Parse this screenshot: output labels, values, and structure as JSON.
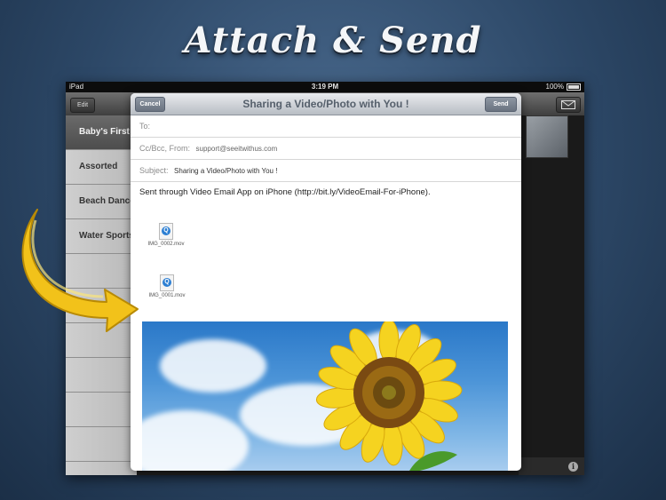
{
  "headline": "Attach & Send",
  "status_bar": {
    "device": "iPad",
    "time": "3:19 PM",
    "battery": "100%"
  },
  "navbar": {
    "edit_label": "Edit"
  },
  "sidebar": {
    "items": [
      {
        "label": "Baby's First",
        "selected": true
      },
      {
        "label": "Assorted",
        "selected": false
      },
      {
        "label": "Beach Dance",
        "selected": false
      },
      {
        "label": "Water Sports",
        "selected": false
      }
    ]
  },
  "compose": {
    "title": "Sharing a Video/Photo with You !",
    "cancel_label": "Cancel",
    "send_label": "Send",
    "to_label": "To:",
    "to_value": "",
    "ccbcc_label": "Cc/Bcc, From:",
    "from_value": "support@seeitwithus.com",
    "subject_label": "Subject:",
    "subject_value": "Sharing a Video/Photo with You !",
    "body_text": "Sent through Video Email App on iPhone (http://bit.ly/VideoEmail-For-iPhone).",
    "attachments": [
      {
        "name": "IMG_0002.mov",
        "icon": "quicktime-file-icon"
      },
      {
        "name": "IMG_0001.mov",
        "icon": "quicktime-file-icon"
      }
    ],
    "photo_icon": "sunflower-photo"
  },
  "colors": {
    "accent_arrow": "#f2c21a",
    "modal_bar": "#b8bdc4",
    "background": "#2c4766"
  }
}
